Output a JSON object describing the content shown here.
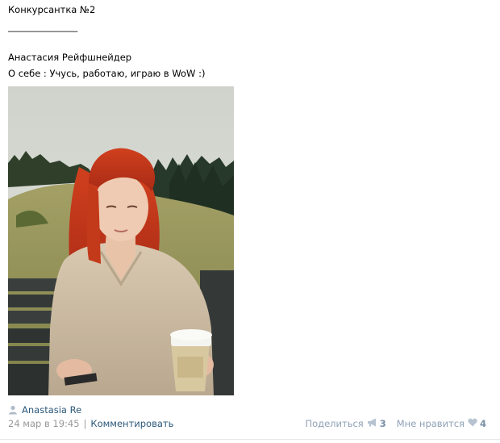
{
  "post": {
    "title": "Конкурсантка №2",
    "rule": "_______________",
    "name": "Анастасия Рейфшнейдер",
    "about": "О себе : Учусь, работаю, играю в WoW :)"
  },
  "photo": {
    "description": "Photo of a red-haired woman sitting on a park bench holding a coffee cup"
  },
  "author": {
    "icon": "user-icon",
    "name": "Anastasia Re"
  },
  "meta": {
    "date": "24 мар в 19:45",
    "separator": "|",
    "comment_label": "Комментировать"
  },
  "actions": {
    "share_label": "Поделиться",
    "share_icon": "megaphone-icon",
    "share_count": "3",
    "like_label": "Мне нравится",
    "like_icon": "heart-icon",
    "like_count": "4"
  },
  "colors": {
    "link": "#2b587a",
    "muted": "#999999",
    "action": "#90a1b6"
  }
}
